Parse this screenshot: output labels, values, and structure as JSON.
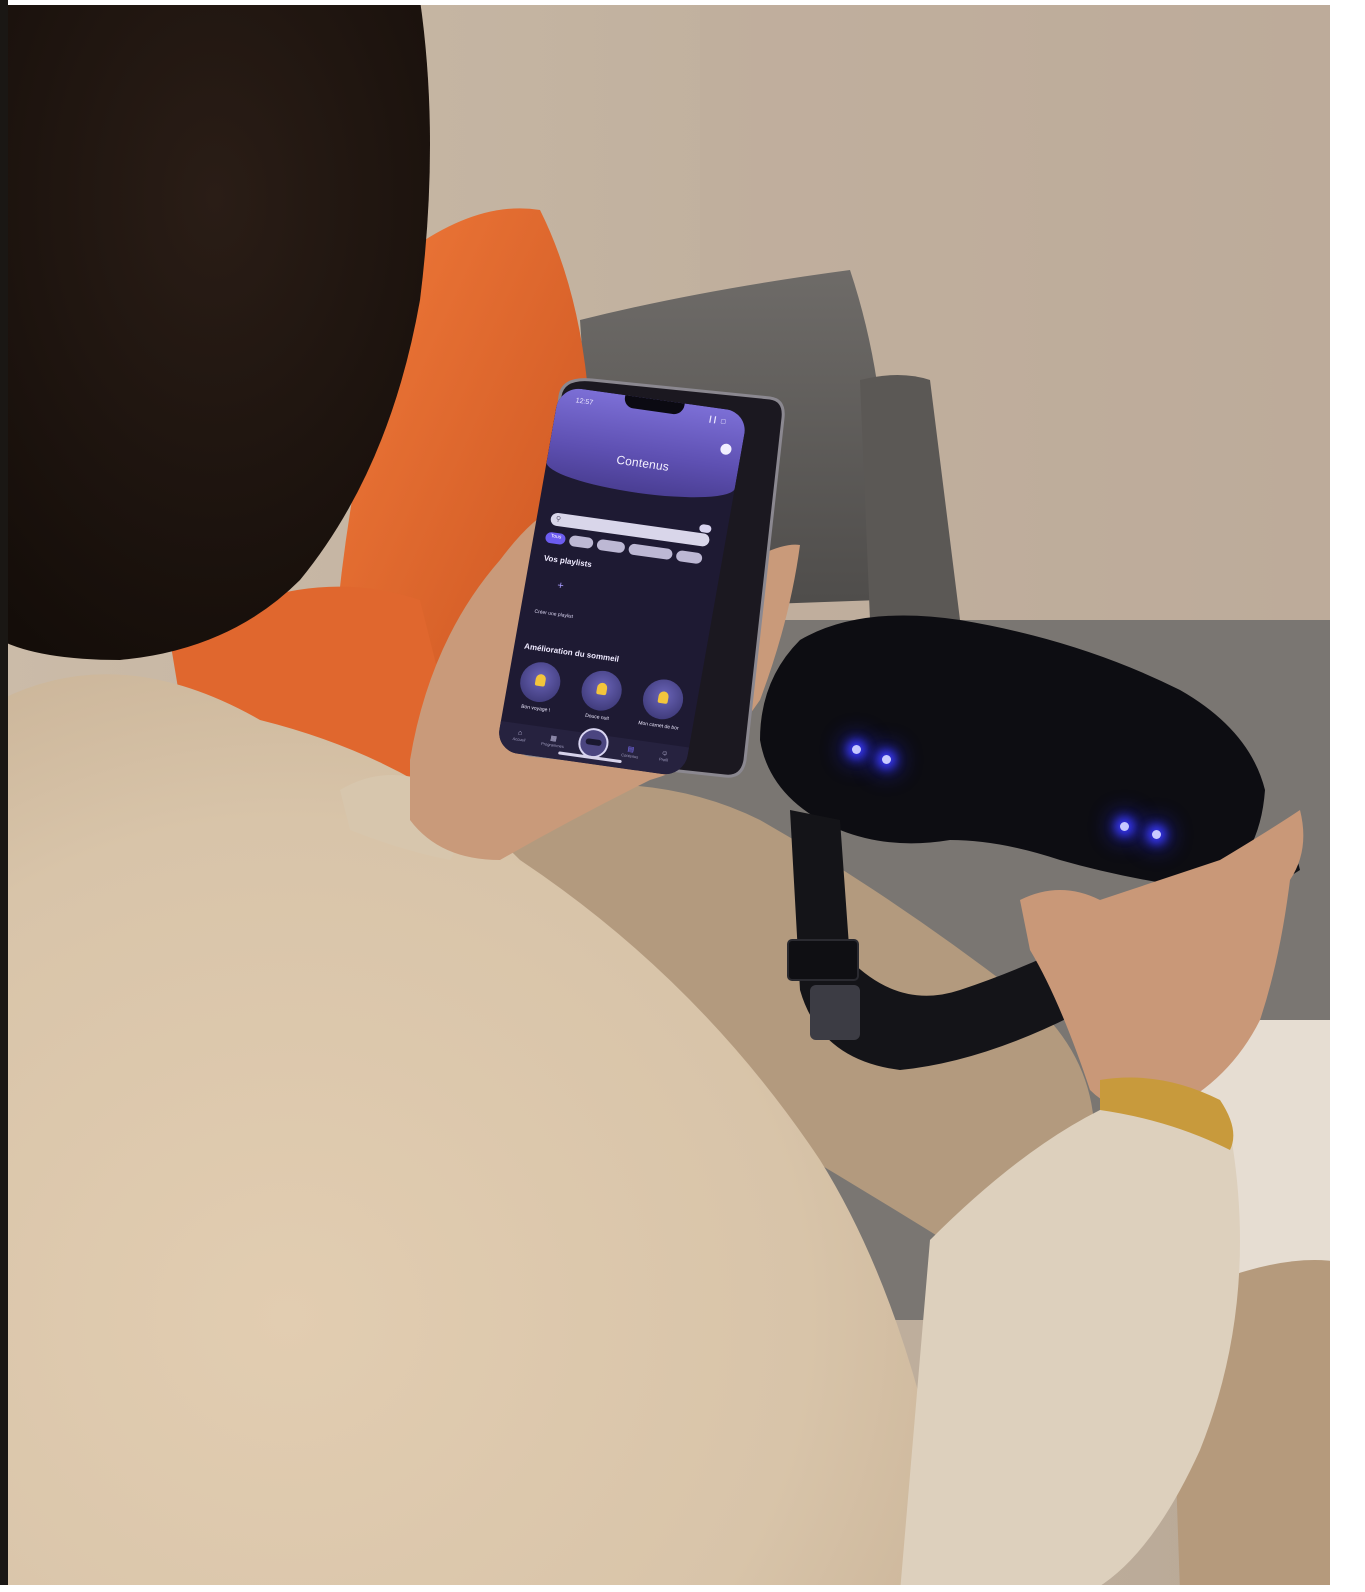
{
  "phone_app": {
    "status_time": "12:57",
    "status_icons": "▎▎ ▢",
    "screen_title": "Contenus",
    "search_placeholder": "",
    "chips": [
      {
        "label": "Tous",
        "active": true
      },
      {
        "label": "",
        "active": false
      },
      {
        "label": "",
        "active": false
      },
      {
        "label": "",
        "active": false
      },
      {
        "label": "",
        "active": false
      }
    ],
    "section_playlists": "Vos playlists",
    "create_playlist_label": "Créer une playlist",
    "add_icon_glyph": "+",
    "section_sleep": "Amélioration du sommeil",
    "cards": [
      {
        "title": "Bon voyage !",
        "subtitle": ""
      },
      {
        "title": "Douce nuit",
        "subtitle": ""
      },
      {
        "title": "Mon carnet de bor",
        "subtitle": ""
      }
    ],
    "tabs": [
      {
        "label": "Accueil",
        "glyph": "⌂"
      },
      {
        "label": "Programmes",
        "glyph": "▦"
      },
      {
        "label": "",
        "glyph": ""
      },
      {
        "label": "Contenus",
        "glyph": "▤"
      },
      {
        "label": "Profil",
        "glyph": "☺"
      }
    ]
  },
  "colors": {
    "app_accent": "#6c5cf0",
    "app_background": "#1e1a33",
    "led_blue": "#3b3bff",
    "pillow_orange": "#e0672e",
    "sweater_beige": "#d9c8b0"
  }
}
